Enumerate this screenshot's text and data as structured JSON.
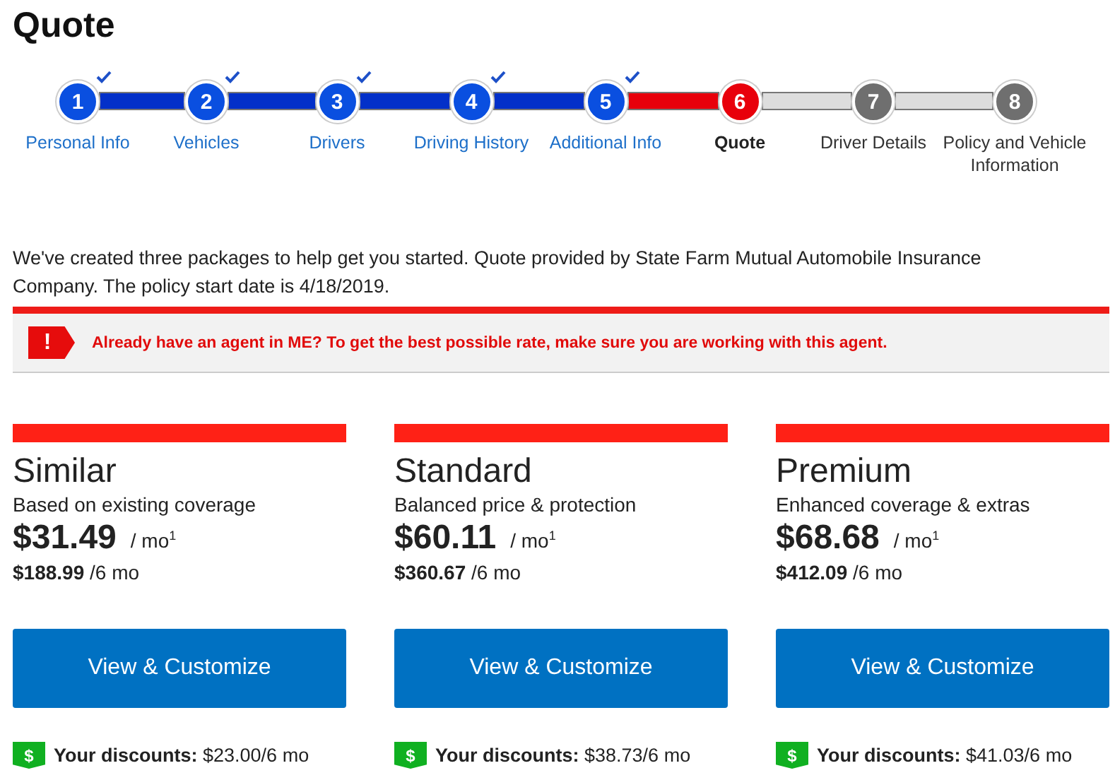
{
  "title": "Quote",
  "steps": [
    {
      "number": "1",
      "label": "Personal Info",
      "completed": true,
      "selected": false
    },
    {
      "number": "2",
      "label": "Vehicles",
      "completed": true,
      "selected": false
    },
    {
      "number": "3",
      "label": "Drivers",
      "completed": true,
      "selected": false
    },
    {
      "number": "4",
      "label": "Driving History",
      "completed": true,
      "selected": false
    },
    {
      "number": "5",
      "label": "Additional Info",
      "completed": true,
      "selected": false
    },
    {
      "number": "6",
      "label": "Quote",
      "completed": false,
      "selected": true
    },
    {
      "number": "7",
      "label": "Driver Details",
      "completed": false,
      "selected": false
    },
    {
      "number": "8",
      "label": "Policy and Vehicle Information",
      "completed": false,
      "selected": false
    }
  ],
  "intro": "We've created three packages to help get you started. Quote provided by State Farm Mutual Automobile Insurance Company. The policy start date is 4/18/2019.",
  "alert": {
    "icon": "!",
    "message": "Already have an agent in ME? To get the best possible rate, make sure you are working with this agent."
  },
  "packages": [
    {
      "name": "Similar",
      "tagline": "Based on existing coverage",
      "monthly": "$31.49",
      "per_month": "/ mo$^{1}$",
      "six_month": "**$188.99** /6 mo",
      "button": "View & Customize",
      "discount_icon": "$",
      "discounts": "**Your discounts:** $23.00/6 mo"
    },
    {
      "name": "Standard",
      "tagline": "Balanced price & protection",
      "monthly": "$60.11",
      "per_month": "/ mo$^{1}$",
      "six_month": "**$360.67** /6 mo",
      "button": "View & Customize",
      "discount_icon": "$",
      "discounts": "**Your discounts:** $38.73/6 mo"
    },
    {
      "name": "Premium",
      "tagline": "Enhanced coverage & extras",
      "monthly": "$68.68",
      "per_month": "/ mo$^{1}$",
      "six_month": "**$412.09** /6 mo",
      "button": "View & Customize",
      "discount_icon": "$",
      "discounts": "**Your discounts:** $41.03/6 mo"
    }
  ]
}
